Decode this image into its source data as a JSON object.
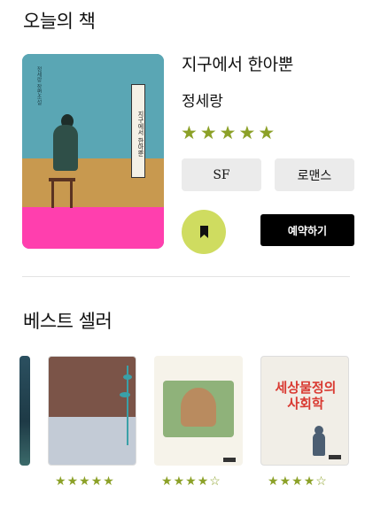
{
  "today": {
    "section_title": "오늘의 책",
    "book": {
      "title": "지구에서 한아뿐",
      "author": "정세랑",
      "rating": 5,
      "genres": [
        "SF",
        "로맨스"
      ],
      "cover": {
        "title": "지구에서 한아뿐",
        "author": "정세랑 장편소설"
      }
    },
    "reserve_label": "예약하기",
    "bookmark_icon": "bookmark-icon"
  },
  "bestseller": {
    "section_title": "베스트 셀러",
    "books": [
      {
        "rating": null
      },
      {
        "rating": 5
      },
      {
        "rating": 4
      },
      {
        "rating": 4,
        "cover_title": "세상물정의 사회학"
      }
    ]
  },
  "colors": {
    "star": "#8ca128",
    "bookmark_bg": "#cfdc60",
    "reserve_bg": "#000000",
    "genre_bg": "#ebebeb"
  }
}
